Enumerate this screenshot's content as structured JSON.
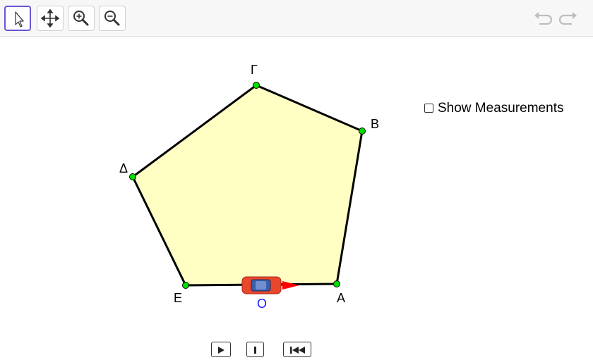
{
  "toolbar": {
    "tools": [
      {
        "name": "select-tool",
        "icon": "arrow-pointer-icon",
        "active": true
      },
      {
        "name": "move-graphics-view-tool",
        "icon": "move-arrows-icon",
        "active": false
      },
      {
        "name": "zoom-in-tool",
        "icon": "zoom-in-icon",
        "active": false
      },
      {
        "name": "zoom-out-tool",
        "icon": "zoom-out-icon",
        "active": false
      }
    ],
    "undo_icon": "undo-icon",
    "redo_icon": "redo-icon",
    "accent_color": "#6557d2"
  },
  "figure": {
    "fill_color": "#ffffc4",
    "point_color": "#00e000",
    "vertices": [
      {
        "label": "Γ"
      },
      {
        "label": "Β"
      },
      {
        "label": "Δ"
      },
      {
        "label": "Ε"
      },
      {
        "label": "Α"
      }
    ],
    "car_label": "O",
    "car_label_color": "#1a1aff",
    "car_color": "#e8472c",
    "arrow_color": "#ff0000"
  },
  "controls": {
    "show_measurements_label": "Show Measurements",
    "show_measurements_checked": false
  },
  "animation": {
    "buttons": [
      "play-icon",
      "step-icon",
      "rewind-icon"
    ]
  }
}
